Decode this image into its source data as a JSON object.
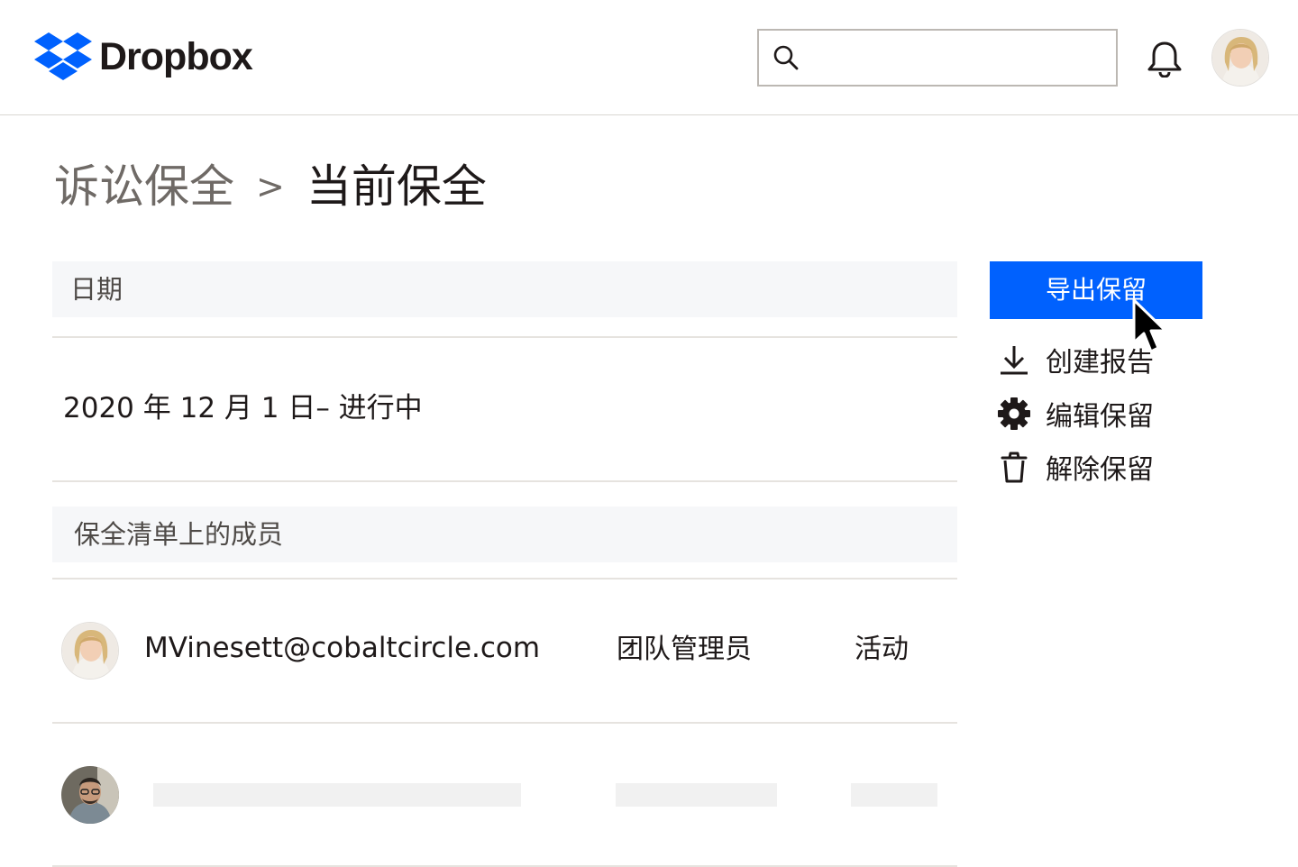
{
  "header": {
    "brand": "Dropbox",
    "search_placeholder": "",
    "icons": [
      "dropbox-logo-icon",
      "search-icon",
      "bell-icon"
    ]
  },
  "breadcrumb": {
    "parent": "诉讼保全",
    "separator": ">",
    "current": "当前保全"
  },
  "date_section": {
    "heading": "日期",
    "value": "2020 年 12 月 1 日– 进行中"
  },
  "members_section": {
    "heading": "保全清单上的成员",
    "rows": [
      {
        "email": "MVinesett@cobaltcircle.com",
        "role": "团队管理员",
        "status": "活动"
      }
    ]
  },
  "actions": {
    "export_label": "导出保留",
    "items": [
      {
        "icon": "download-icon",
        "label": "创建报告"
      },
      {
        "icon": "gear-icon",
        "label": "编辑保留"
      },
      {
        "icon": "trash-icon",
        "label": "解除保留"
      }
    ]
  },
  "colors": {
    "accent": "#0061fe",
    "brand_blue": "#0061fe",
    "section_bg": "#f6f7f9",
    "divider": "#e6e3df"
  }
}
